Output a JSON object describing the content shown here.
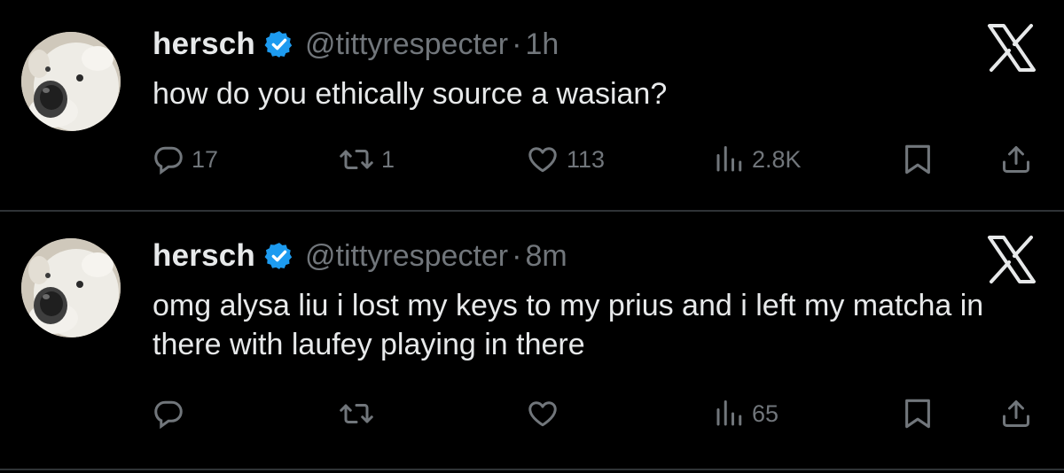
{
  "tweets": [
    {
      "name": "hersch",
      "handle": "@tittyrespecter",
      "separator": "·",
      "time": "1h",
      "text": "how do you ethically source a wasian?",
      "replies": "17",
      "retweets": "1",
      "likes": "113",
      "views": "2.8K",
      "platform_icon": "x-logo-icon"
    },
    {
      "name": "hersch",
      "handle": "@tittyrespecter",
      "separator": "·",
      "time": "8m",
      "text": "omg alysa liu i lost my keys to my prius and i left my matcha in there with laufey playing in there",
      "replies": "",
      "retweets": "",
      "likes": "",
      "views": "65",
      "platform_icon": "x-logo-icon"
    }
  ],
  "colors": {
    "background": "#000000",
    "primary_text": "#e7e9ea",
    "secondary_text": "#71767b",
    "verified_badge": "#1d9bf0",
    "divider": "#2f3336"
  }
}
